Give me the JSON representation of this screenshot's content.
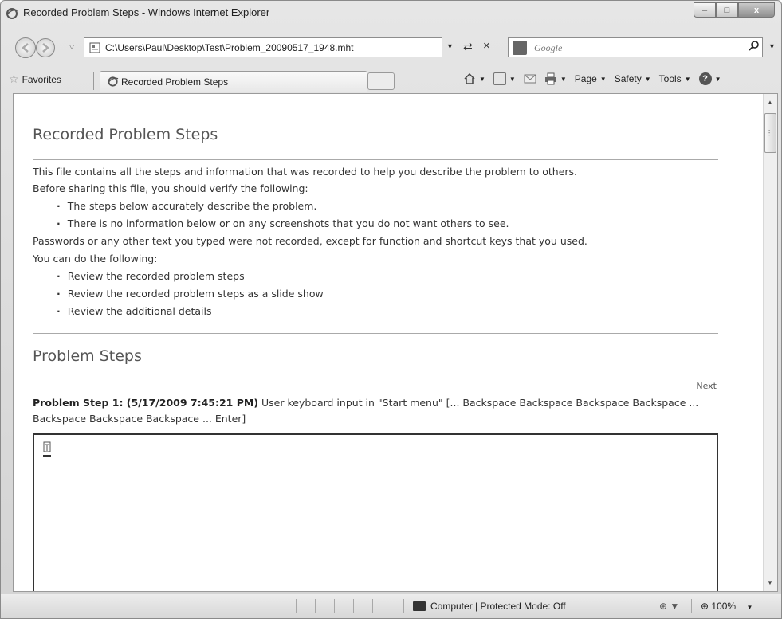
{
  "window": {
    "title": "Recorded Problem Steps - Windows Internet Explorer",
    "minimize": "–",
    "maximize": "□",
    "close": "x"
  },
  "address_bar": {
    "url": "C:\\Users\\Paul\\Desktop\\Test\\Problem_20090517_1948.mht",
    "refresh_glyph": "⇄",
    "stop_glyph": "×"
  },
  "search": {
    "placeholder": "Google",
    "go_glyph": "⌕"
  },
  "favorites_bar": {
    "favorites_label": "Favorites",
    "tab_label": "Recorded Problem Steps",
    "commands": {
      "page": "Page",
      "safety": "Safety",
      "tools": "Tools"
    }
  },
  "document": {
    "title": "Recorded Problem Steps",
    "intro_1": "This file contains all the steps and information that was recorded to help you describe the problem to others.",
    "intro_2": "Before sharing this file, you should verify the following:",
    "verify_items": [
      "The steps below accurately describe the problem.",
      "There is no information below or on any screenshots that you do not want others to see."
    ],
    "passwords_note": "Passwords or any other text you typed were not recorded, except for function and shortcut keys that you used.",
    "can_do": "You can do the following:",
    "actions": [
      "Review the recorded problem steps",
      "Review the recorded problem steps as a slide show",
      "Review the additional details"
    ],
    "steps_heading": "Problem Steps",
    "next_label": "Next",
    "step_1_heading": "Problem Step 1: (5/17/2009 7:45:21 PM)",
    "step_1_text": " User keyboard input in \"Start menu\" [... Backspace Backspace Backspace Backspace ... Backspace Backspace Backspace ... Enter]"
  },
  "status_bar": {
    "zone": "Computer | Protected Mode: Off",
    "zoom": "100%"
  },
  "icons": [
    "ie-icon",
    "back-icon",
    "forward-icon",
    "page-icon",
    "refresh-icon",
    "stop-icon",
    "search-icon",
    "star-icon",
    "home-icon",
    "feeds-icon",
    "mail-icon",
    "print-icon",
    "help-icon",
    "computer-icon",
    "security-icon",
    "zoom-icon"
  ]
}
